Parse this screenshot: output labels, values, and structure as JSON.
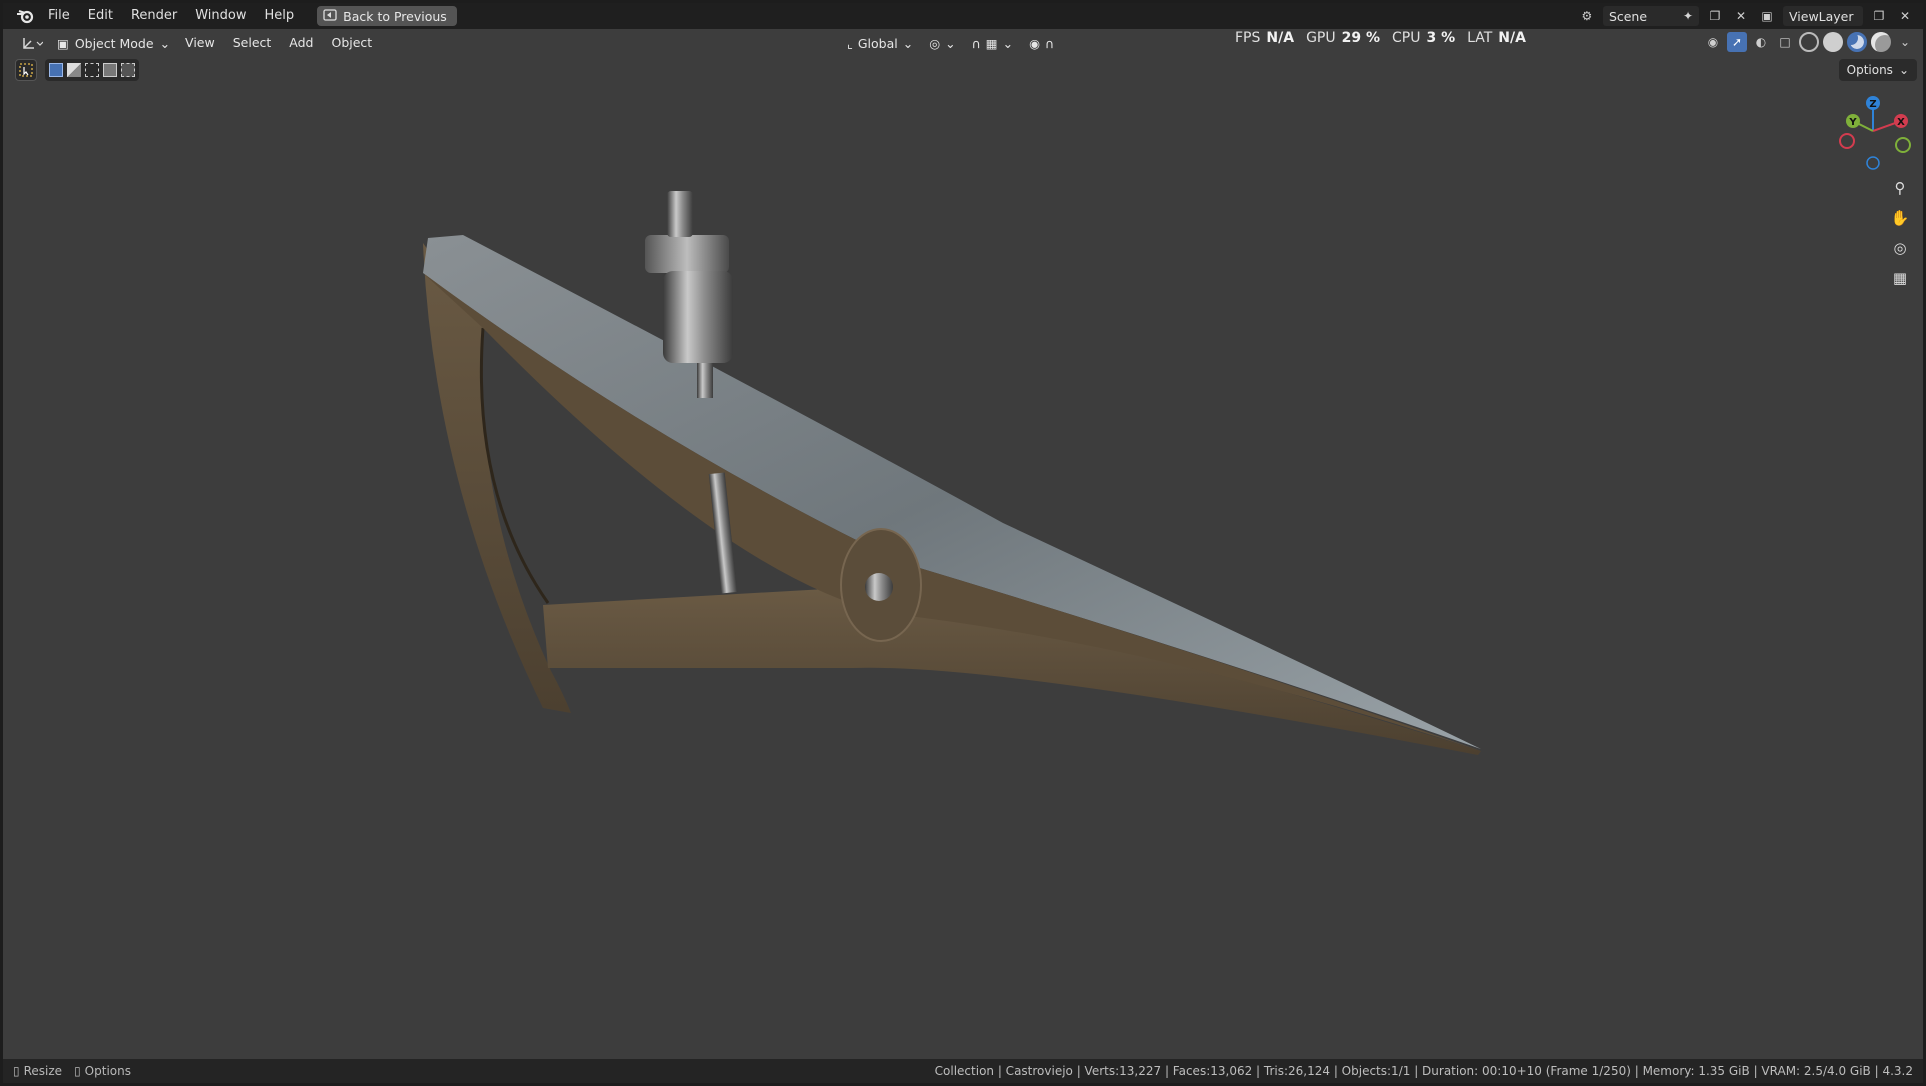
{
  "menubar": {
    "items": [
      "File",
      "Edit",
      "Render",
      "Window",
      "Help"
    ],
    "back_button": "Back to Previous",
    "scene": "Scene",
    "view_layer": "ViewLayer"
  },
  "viewport_header": {
    "mode": "Object Mode",
    "menus": [
      "View",
      "Select",
      "Add",
      "Object"
    ],
    "transform_orientation": "Global",
    "options": "Options"
  },
  "stats": {
    "fps_label": "FPS",
    "fps_value": "N/A",
    "gpu_label": "GPU",
    "gpu_value": "29 %",
    "cpu_label": "CPU",
    "cpu_value": "3 %",
    "lat_label": "LAT",
    "lat_value": "N/A"
  },
  "gizmo": {
    "z": "Z",
    "y": "Y",
    "x": "X"
  },
  "statusbar": {
    "left_1": "Resize",
    "left_2": "Options",
    "right": "Collection | Castroviejo | Verts:13,227 | Faces:13,062 | Tris:26,124 | Objects:1/1 | Duration: 00:10+10 (Frame 1/250) | Memory: 1.35 GiB | VRAM: 2.5/4.0 GiB | 4.3.2"
  },
  "colors": {
    "menubar_bg": "#1f1f1f",
    "viewport_bg": "#3d3d3d",
    "accent_blue": "#4772b3",
    "axis_x": "#d33c4f",
    "axis_y": "#7fb03a",
    "axis_z": "#2f83d8"
  }
}
